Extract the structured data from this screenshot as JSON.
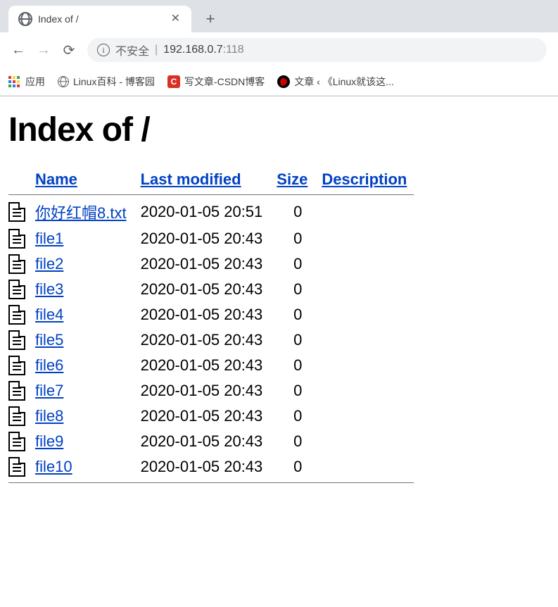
{
  "browser": {
    "tab_title": "Index of /",
    "address": {
      "not_secure_text": "不安全",
      "host": "192.168.0.7",
      "port": ":118"
    },
    "apps_label": "应用",
    "bookmarks": [
      {
        "label": "Linux百科 - 博客园",
        "icon": "generic"
      },
      {
        "label": "写文章-CSDN博客",
        "icon": "csdn"
      },
      {
        "label": "文章 ‹ 《Linux就该这...",
        "icon": "redhat"
      }
    ]
  },
  "page": {
    "title": "Index of /",
    "columns": {
      "name": "Name",
      "modified": "Last modified",
      "size": "Size",
      "description": "Description"
    },
    "files": [
      {
        "name": "你好红帽8.txt",
        "modified": "2020-01-05 20:51",
        "size": "0"
      },
      {
        "name": "file1",
        "modified": "2020-01-05 20:43",
        "size": "0"
      },
      {
        "name": "file2",
        "modified": "2020-01-05 20:43",
        "size": "0"
      },
      {
        "name": "file3",
        "modified": "2020-01-05 20:43",
        "size": "0"
      },
      {
        "name": "file4",
        "modified": "2020-01-05 20:43",
        "size": "0"
      },
      {
        "name": "file5",
        "modified": "2020-01-05 20:43",
        "size": "0"
      },
      {
        "name": "file6",
        "modified": "2020-01-05 20:43",
        "size": "0"
      },
      {
        "name": "file7",
        "modified": "2020-01-05 20:43",
        "size": "0"
      },
      {
        "name": "file8",
        "modified": "2020-01-05 20:43",
        "size": "0"
      },
      {
        "name": "file9",
        "modified": "2020-01-05 20:43",
        "size": "0"
      },
      {
        "name": "file10",
        "modified": "2020-01-05 20:43",
        "size": "0"
      }
    ]
  }
}
